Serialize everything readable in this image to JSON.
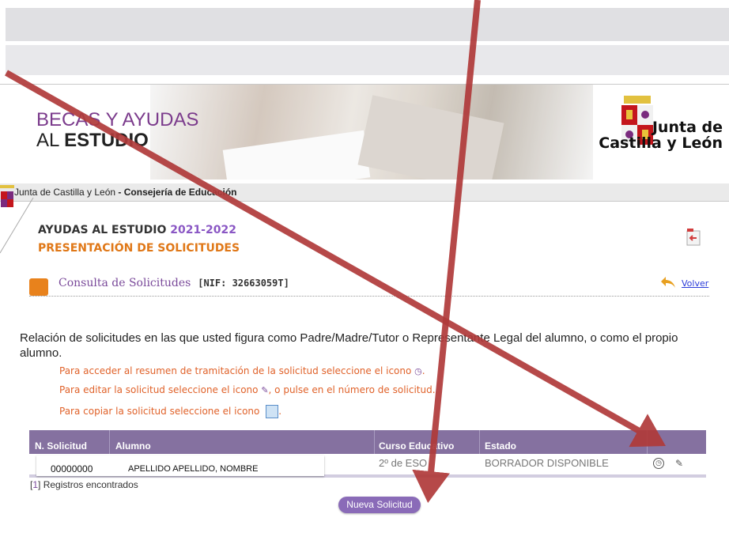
{
  "header": {
    "brand_line1": "BECAS Y AYUDAS",
    "brand_line2_prefix": "AL ",
    "brand_line2_bold": "ESTUDIO",
    "logo_text_line1": "Junta de",
    "logo_text_line2": "Castilla y León"
  },
  "breadcrumb": {
    "org": "Junta de Castilla y León",
    "separator": " - ",
    "department": "Consejería de Educación"
  },
  "page": {
    "title_prefix": "AYUDAS AL ESTUDIO ",
    "title_year": "2021-2022",
    "subtitle": "PRESENTACIÓN DE SOLICITUDES"
  },
  "section": {
    "title": "Consulta de Solicitudes",
    "nif": "[NIF: 32663059T]",
    "back_link": "Volver"
  },
  "intro_text": "Relación de solicitudes en las que usted figura como Padre/Madre/Tutor o Representante Legal del alumno, o como el propio alumno.",
  "hints": {
    "h1_before": "Para acceder al resumen de tramitación de la solicitud seleccione el icono ",
    "h1_icon": "◷",
    "h1_after": ".",
    "h2_before": "Para editar la solicitud seleccione el icono ",
    "h2_icon": "✎",
    "h2_after": ", o pulse en el número de solicitud.",
    "h3_before": "Para copiar la solicitud seleccione el icono ",
    "h3_after": "."
  },
  "table": {
    "headers": [
      "N. Solicitud",
      "Alumno",
      "Curso Educativo",
      "Estado"
    ],
    "row": {
      "number": "00000000",
      "alumno": "APELLIDO APELLIDO, NOMBRE",
      "curso": "2º de ESO",
      "estado": "BORRADOR DISPONIBLE",
      "clock_icon": "◷",
      "pencil_icon": "✎"
    }
  },
  "records": {
    "open": "[",
    "count": "1",
    "close": "]",
    "label": " Registros encontrados"
  },
  "new_button": "Nueva Solicitud",
  "colors": {
    "accent_purple": "#8571a0",
    "accent_orange": "#e07818",
    "arrow_red": "#b03a3a",
    "link_blue": "#2a3bd9"
  },
  "icons": [
    "exit-icon",
    "consulta-icon",
    "volver-icon",
    "clock-icon",
    "pencil-icon",
    "copy-icon",
    "shield-icon"
  ]
}
